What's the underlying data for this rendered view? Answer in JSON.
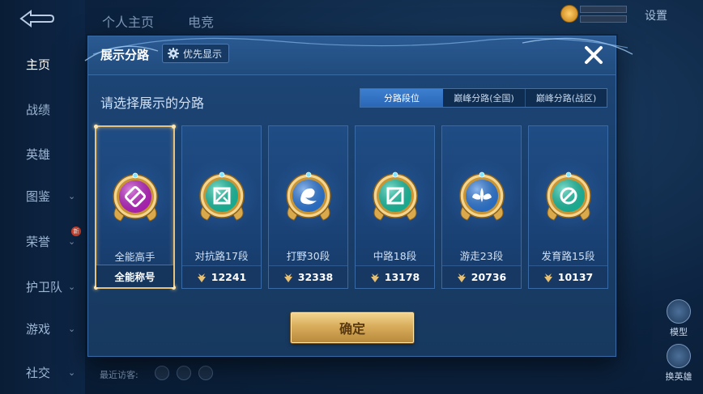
{
  "background": {
    "sidebar": [
      {
        "label": "主页",
        "has_chevron": false,
        "active": true
      },
      {
        "label": "战绩",
        "has_chevron": false
      },
      {
        "label": "英雄",
        "has_chevron": false
      },
      {
        "label": "图鉴",
        "has_chevron": true
      },
      {
        "label": "荣誉",
        "has_chevron": true,
        "badge": "新"
      },
      {
        "label": "护卫队",
        "has_chevron": true
      },
      {
        "label": "游戏",
        "has_chevron": true
      },
      {
        "label": "社交",
        "has_chevron": true
      }
    ],
    "top_tabs": [
      "个人主页",
      "电竞"
    ],
    "settings_label": "设置",
    "right_tools": [
      {
        "label": "模型",
        "icon": "mech-icon"
      },
      {
        "label": "换英雄",
        "icon": "swap-hero-icon"
      }
    ],
    "recent_visitors_label": "最近访客:"
  },
  "modal": {
    "title": "展示分路",
    "priority_button": {
      "label": "优先显示",
      "icon": "gear-icon"
    },
    "close_icon": "close-icon",
    "subtitle": "请选择展示的分路",
    "segments": [
      {
        "label": "分路段位",
        "active": true
      },
      {
        "label": "巅峰分路(全国)",
        "active": false
      },
      {
        "label": "巅峰分路(战区)",
        "active": false
      }
    ],
    "cards": [
      {
        "name": "全能高手",
        "footer": "全能称号",
        "has_points_icon": false,
        "selected": true,
        "emblem": "all-round-emblem-icon",
        "accent": "#c026c9"
      },
      {
        "name": "对抗路17段",
        "footer": "12241",
        "has_points_icon": true,
        "selected": false,
        "emblem": "clash-lane-emblem-icon",
        "accent": "#1cc7a8"
      },
      {
        "name": "打野30段",
        "footer": "32338",
        "has_points_icon": true,
        "selected": false,
        "emblem": "jungle-emblem-icon",
        "accent": "#2f7de0"
      },
      {
        "name": "中路18段",
        "footer": "13178",
        "has_points_icon": true,
        "selected": false,
        "emblem": "mid-lane-emblem-icon",
        "accent": "#1cc7a8"
      },
      {
        "name": "游走23段",
        "footer": "20736",
        "has_points_icon": true,
        "selected": false,
        "emblem": "roam-emblem-icon",
        "accent": "#2f7de0"
      },
      {
        "name": "发育路15段",
        "footer": "10137",
        "has_points_icon": true,
        "selected": false,
        "emblem": "farm-lane-emblem-icon",
        "accent": "#1cc7a8"
      }
    ],
    "confirm_label": "确定"
  }
}
